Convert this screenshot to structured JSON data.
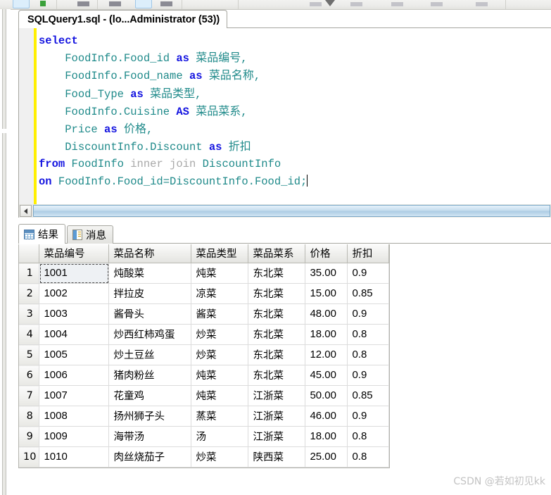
{
  "window": {
    "document_tab_title": "SQLQuery1.sql - (lo...Administrator (53))"
  },
  "toolbar": {
    "items": [
      "new-query-button",
      "execute-button",
      "parse-button",
      "debug-button",
      "stop-button",
      "results-to-grid-button",
      "dropdown-caret"
    ]
  },
  "editor": {
    "lines": [
      {
        "indent": 0,
        "tokens": [
          {
            "t": "select",
            "c": "kw"
          }
        ]
      },
      {
        "indent": 4,
        "tokens": [
          {
            "t": "FoodInfo.Food_id ",
            "c": "id"
          },
          {
            "t": "as ",
            "c": "kw"
          },
          {
            "t": "菜品编号",
            "c": "cn"
          },
          {
            "t": ",",
            "c": "punct"
          }
        ]
      },
      {
        "indent": 4,
        "tokens": [
          {
            "t": "FoodInfo.Food_name ",
            "c": "id"
          },
          {
            "t": "as ",
            "c": "kw"
          },
          {
            "t": "菜品名称",
            "c": "cn"
          },
          {
            "t": ",",
            "c": "punct"
          }
        ]
      },
      {
        "indent": 4,
        "tokens": [
          {
            "t": "Food_Type ",
            "c": "id"
          },
          {
            "t": "as ",
            "c": "kw"
          },
          {
            "t": "菜品类型",
            "c": "cn"
          },
          {
            "t": ",",
            "c": "punct"
          }
        ]
      },
      {
        "indent": 4,
        "tokens": [
          {
            "t": "FoodInfo.Cuisine ",
            "c": "id"
          },
          {
            "t": "AS ",
            "c": "kw"
          },
          {
            "t": "菜品菜系",
            "c": "cn"
          },
          {
            "t": ",",
            "c": "punct"
          }
        ]
      },
      {
        "indent": 4,
        "tokens": [
          {
            "t": "Price ",
            "c": "id"
          },
          {
            "t": "as ",
            "c": "kw"
          },
          {
            "t": "价格",
            "c": "cn"
          },
          {
            "t": ",",
            "c": "punct"
          }
        ]
      },
      {
        "indent": 4,
        "tokens": [
          {
            "t": "DiscountInfo.Discount ",
            "c": "id"
          },
          {
            "t": "as ",
            "c": "kw"
          },
          {
            "t": "折扣",
            "c": "cn"
          }
        ]
      },
      {
        "indent": 0,
        "tokens": [
          {
            "t": "from ",
            "c": "kw"
          },
          {
            "t": "FoodInfo ",
            "c": "id"
          },
          {
            "t": "inner join ",
            "c": "gray"
          },
          {
            "t": "DiscountInfo",
            "c": "id"
          }
        ]
      },
      {
        "indent": 0,
        "tokens": [
          {
            "t": "on ",
            "c": "kw"
          },
          {
            "t": "FoodInfo.Food_id=DiscountInfo.Food_id;",
            "c": "id"
          }
        ],
        "caret": true
      }
    ],
    "scrollbar": {
      "left_arrow": "◀"
    }
  },
  "results": {
    "tabs": [
      {
        "label": "结果",
        "icon": "grid-icon",
        "active": true
      },
      {
        "label": "消息",
        "icon": "message-icon",
        "active": false
      }
    ],
    "columns": [
      "菜品编号",
      "菜品名称",
      "菜品类型",
      "菜品菜系",
      "价格",
      "折扣"
    ],
    "rows": [
      {
        "n": "1",
        "cells": [
          "1001",
          "炖酸菜",
          "炖菜",
          "东北菜",
          "35.00",
          "0.9"
        ]
      },
      {
        "n": "2",
        "cells": [
          "1002",
          "拌拉皮",
          "凉菜",
          "东北菜",
          "15.00",
          "0.85"
        ]
      },
      {
        "n": "3",
        "cells": [
          "1003",
          "酱骨头",
          "酱菜",
          "东北菜",
          "48.00",
          "0.9"
        ]
      },
      {
        "n": "4",
        "cells": [
          "1004",
          "炒西红柿鸡蛋",
          "炒菜",
          "东北菜",
          "18.00",
          "0.8"
        ]
      },
      {
        "n": "5",
        "cells": [
          "1005",
          "炒土豆丝",
          "炒菜",
          "东北菜",
          "12.00",
          "0.8"
        ]
      },
      {
        "n": "6",
        "cells": [
          "1006",
          "猪肉粉丝",
          "炖菜",
          "东北菜",
          "45.00",
          "0.9"
        ]
      },
      {
        "n": "7",
        "cells": [
          "1007",
          "花童鸡",
          "炖菜",
          "江浙菜",
          "50.00",
          "0.85"
        ]
      },
      {
        "n": "8",
        "cells": [
          "1008",
          "扬州狮子头",
          "蒸菜",
          "江浙菜",
          "46.00",
          "0.9"
        ]
      },
      {
        "n": "9",
        "cells": [
          "1009",
          "海带汤",
          "汤",
          "江浙菜",
          "18.00",
          "0.8"
        ]
      },
      {
        "n": "10",
        "cells": [
          "1010",
          "肉丝烧茄子",
          "炒菜",
          "陕西菜",
          "25.00",
          "0.8"
        ]
      }
    ],
    "focused_cell": {
      "row": 0,
      "col": 0
    }
  },
  "watermark": {
    "text": "CSDN @若如初见kk"
  },
  "colors": {
    "keyword": "#1515e0",
    "identifier": "#1f8a8a",
    "gray_token": "#a9a9a9",
    "change_bar": "#ffef00",
    "number_cell": "#2a2a6a",
    "price_cell": "#8a6a1a"
  }
}
